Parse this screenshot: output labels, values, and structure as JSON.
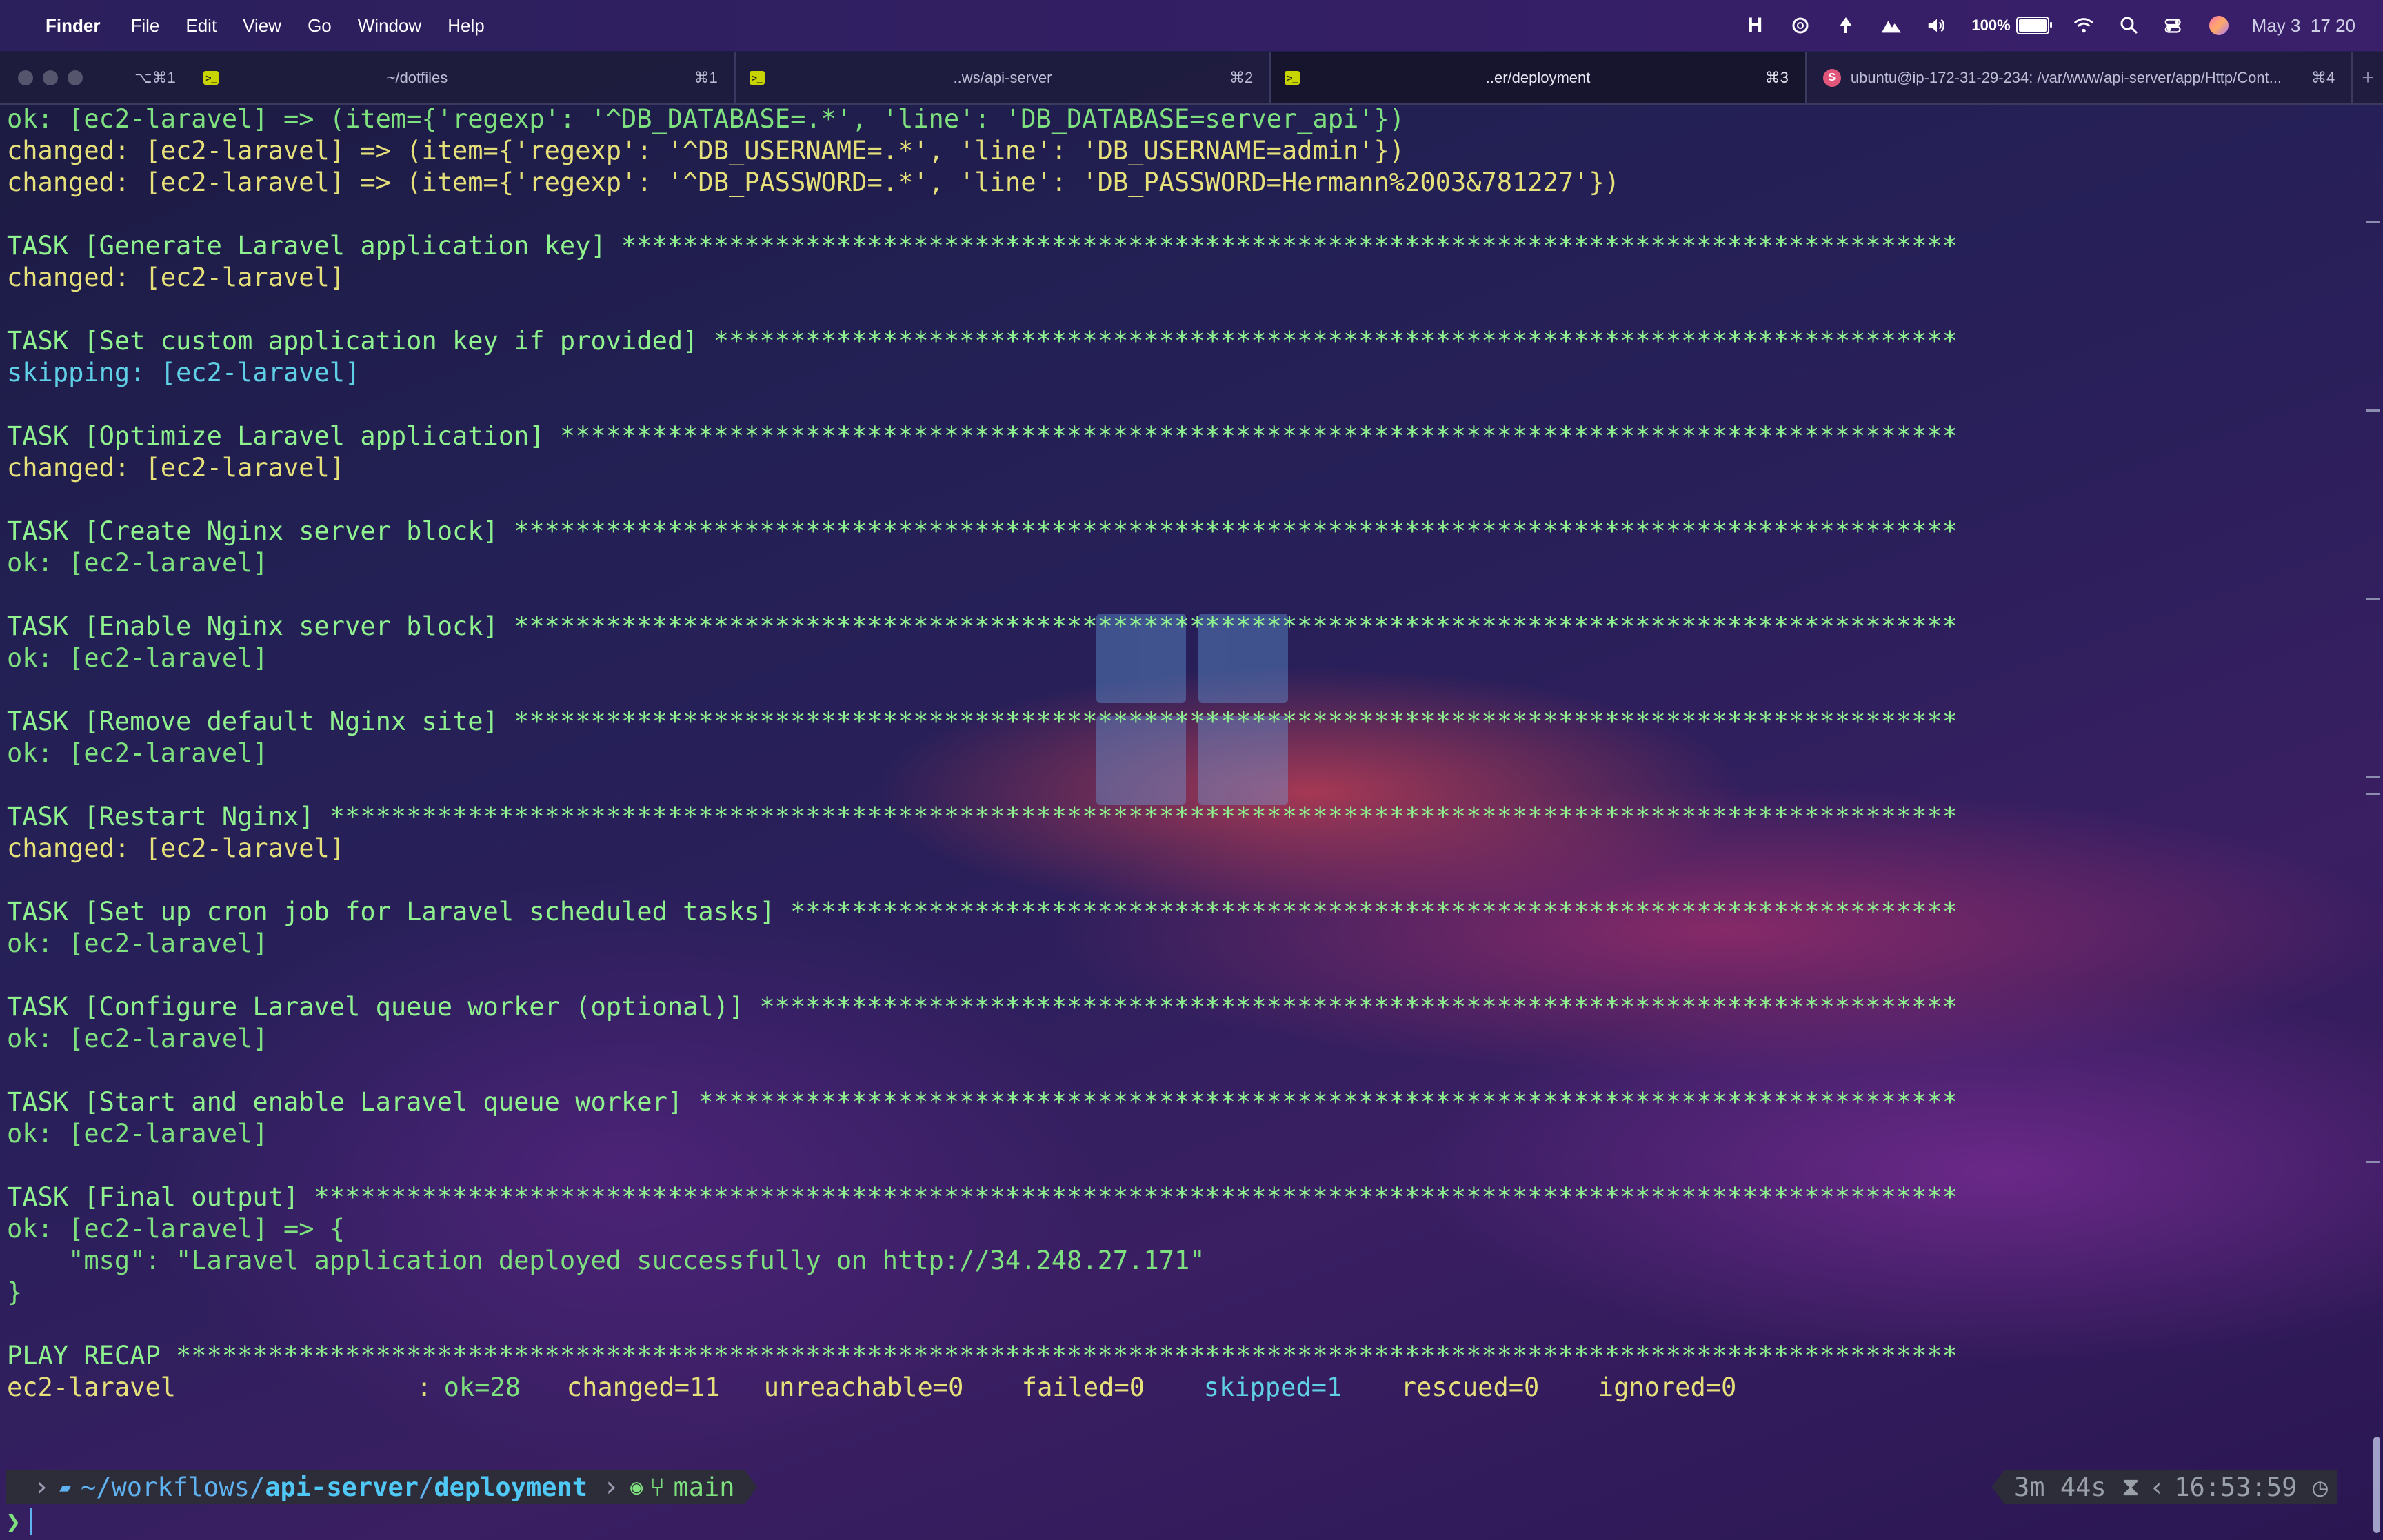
{
  "menubar": {
    "apple": "",
    "app": "Finder",
    "items": [
      "File",
      "Edit",
      "View",
      "Go",
      "Window",
      "Help"
    ],
    "battery_label": "100%",
    "battery_level": 1.0,
    "date": "May 3",
    "time": "17 20",
    "icons": [
      "h-icon",
      "openai-icon",
      "tree-icon",
      "mountain-icon",
      "volume-icon",
      "battery-icon",
      "wifi-icon",
      "search-icon",
      "control-center-icon",
      "avatar"
    ]
  },
  "tabs": [
    {
      "title": "~/dotfiles",
      "hotkey_left": "⌥⌘1",
      "shortcut": "⌘1"
    },
    {
      "title": "..ws/api-server",
      "shortcut": "⌘2"
    },
    {
      "title": "..er/deployment",
      "shortcut": "⌘3"
    },
    {
      "title": "ubuntu@ip-172-31-29-234: /var/www/api-server/app/Http/Cont...",
      "shortcut": "⌘4"
    }
  ],
  "tab_plus": "+",
  "terminal": {
    "lines": [
      {
        "text": "ok: [ec2-laravel] => (item={'regexp': '^DB_DATABASE=.*', 'line': 'DB_DATABASE=server_api'})",
        "cls": "green"
      },
      {
        "text": "changed: [ec2-laravel] => (item={'regexp': '^DB_USERNAME=.*', 'line': 'DB_USERNAME=admin'})",
        "cls": "yellow"
      },
      {
        "text": "changed: [ec2-laravel] => (item={'regexp': '^DB_PASSWORD=.*', 'line': 'DB_PASSWORD=Hermann%2003&781227'})",
        "cls": "yellow"
      },
      {
        "text": "",
        "cls": "plain"
      },
      {
        "text": "TASK [Generate Laravel application key] ***************************************************************************************",
        "cls": "task"
      },
      {
        "text": "changed: [ec2-laravel]",
        "cls": "yellow"
      },
      {
        "text": "",
        "cls": "plain"
      },
      {
        "text": "TASK [Set custom application key if provided] *********************************************************************************",
        "cls": "task"
      },
      {
        "text": "skipping: [ec2-laravel]",
        "cls": "cyan"
      },
      {
        "text": "",
        "cls": "plain"
      },
      {
        "text": "TASK [Optimize Laravel application] *******************************************************************************************",
        "cls": "task"
      },
      {
        "text": "changed: [ec2-laravel]",
        "cls": "yellow"
      },
      {
        "text": "",
        "cls": "plain"
      },
      {
        "text": "TASK [Create Nginx server block] **********************************************************************************************",
        "cls": "task"
      },
      {
        "text": "ok: [ec2-laravel]",
        "cls": "green"
      },
      {
        "text": "",
        "cls": "plain"
      },
      {
        "text": "TASK [Enable Nginx server block] **********************************************************************************************",
        "cls": "task"
      },
      {
        "text": "ok: [ec2-laravel]",
        "cls": "green"
      },
      {
        "text": "",
        "cls": "plain"
      },
      {
        "text": "TASK [Remove default Nginx site] **********************************************************************************************",
        "cls": "task"
      },
      {
        "text": "ok: [ec2-laravel]",
        "cls": "green"
      },
      {
        "text": "",
        "cls": "plain"
      },
      {
        "text": "TASK [Restart Nginx] **********************************************************************************************************",
        "cls": "task"
      },
      {
        "text": "changed: [ec2-laravel]",
        "cls": "yellow"
      },
      {
        "text": "",
        "cls": "plain"
      },
      {
        "text": "TASK [Set up cron job for Laravel scheduled tasks] ****************************************************************************",
        "cls": "task"
      },
      {
        "text": "ok: [ec2-laravel]",
        "cls": "green"
      },
      {
        "text": "",
        "cls": "plain"
      },
      {
        "text": "TASK [Configure Laravel queue worker (optional)] ******************************************************************************",
        "cls": "task"
      },
      {
        "text": "ok: [ec2-laravel]",
        "cls": "green"
      },
      {
        "text": "",
        "cls": "plain"
      },
      {
        "text": "TASK [Start and enable Laravel queue worker] **********************************************************************************",
        "cls": "task"
      },
      {
        "text": "ok: [ec2-laravel]",
        "cls": "green"
      },
      {
        "text": "",
        "cls": "plain"
      },
      {
        "text": "TASK [Final output] ***********************************************************************************************************",
        "cls": "task"
      },
      {
        "text": "ok: [ec2-laravel] => {",
        "cls": "green"
      },
      {
        "text": "    \"msg\": \"Laravel application deployed successfully on http://34.248.27.171\"",
        "cls": "green"
      },
      {
        "text": "}",
        "cls": "green"
      },
      {
        "text": "",
        "cls": "plain"
      },
      {
        "text": "PLAY RECAP ********************************************************************************************************************",
        "cls": "task"
      }
    ],
    "recap": {
      "host": "ec2-laravel",
      "colon": ":",
      "ok": "ok=28",
      "changed": "changed=11",
      "unreachable": "unreachable=0",
      "failed": "failed=0",
      "skipped": "skipped=1",
      "rescued": "rescued=0",
      "ignored": "ignored=0"
    }
  },
  "prompt": {
    "path_prefix": "~/workflows/",
    "path_bold1": "api-server",
    "path_sep": "/",
    "path_bold2": "deployment",
    "branch": "main",
    "duration": "3m 44s",
    "clock": "16:53:59",
    "input_symbol": "❯"
  }
}
